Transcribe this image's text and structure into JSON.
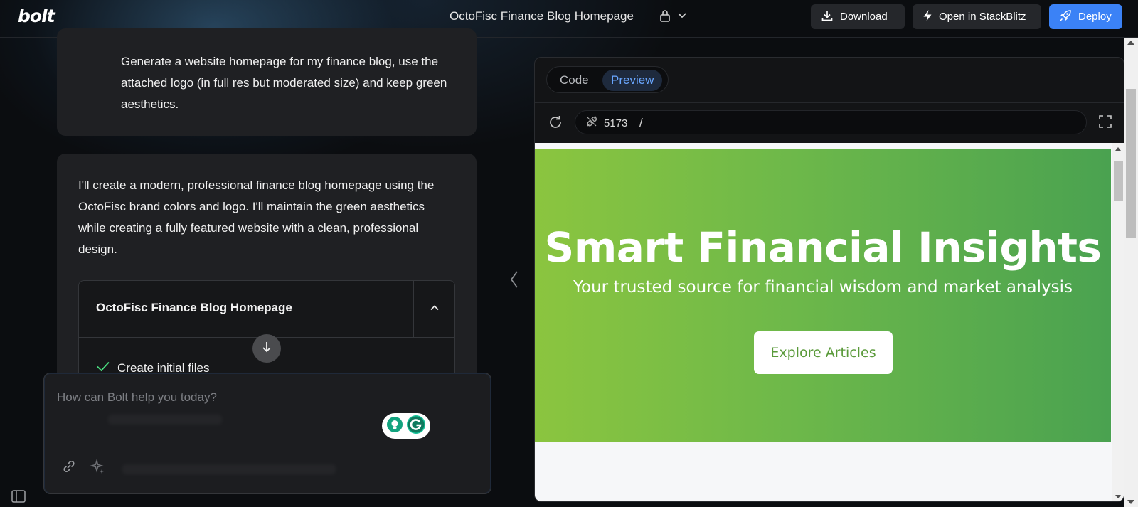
{
  "app": {
    "logo": "bolt",
    "project_title": "OctoFisc Finance Blog Homepage"
  },
  "toolbar": {
    "download_label": "Download",
    "stackblitz_label": "Open in StackBlitz",
    "deploy_label": "Deploy"
  },
  "chat": {
    "user_message": "Generate a website homepage for my finance blog, use the attached logo (in full res but moderated size) and keep green aesthetics.",
    "assistant_message": "I'll create a modern, professional finance blog homepage using the OctoFisc brand colors and logo. I'll maintain the green aesthetics while creating a fully featured website with a clean, professional design.",
    "artifact": {
      "title": "OctoFisc Finance Blog Homepage",
      "items": [
        "Create initial files"
      ]
    },
    "prompt_placeholder": "How can Bolt help you today?"
  },
  "workbench": {
    "tabs": [
      {
        "label": "Code",
        "active": false
      },
      {
        "label": "Preview",
        "active": true
      }
    ],
    "port": "5173",
    "path": "/"
  },
  "preview": {
    "hero_title": "Smart Financial Insights",
    "hero_subtitle": "Your trusted source for financial wisdom and market analysis",
    "cta_label": "Explore Articles"
  },
  "colors": {
    "accent_blue": "#3b82f6",
    "hero_green_start": "#8bc53f",
    "hero_green_end": "#4aa250",
    "check_green": "#4ade80"
  },
  "icons": {
    "download": "download-icon",
    "stackblitz": "lightning-icon",
    "deploy": "rocket-icon",
    "lock": "lock-icon",
    "reload": "reload-icon",
    "port": "plug-icon",
    "fullscreen": "fullscreen-icon",
    "link": "link-icon",
    "enhance": "sparkle-icon",
    "sidebar": "sidebar-toggle-icon"
  }
}
